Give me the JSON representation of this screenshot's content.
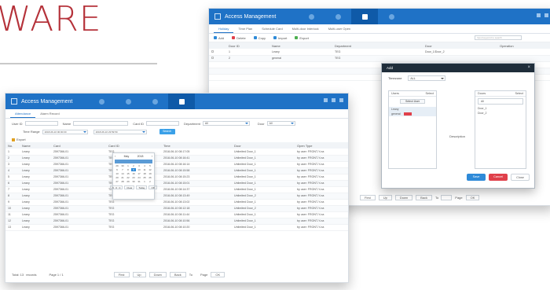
{
  "headline": {
    "text": "WARE"
  },
  "back_window": {
    "title": "Access Management",
    "nav_icons": [
      "person-icon",
      "door-icon",
      "shield-icon",
      "user-active-icon",
      "card-icon"
    ],
    "tabs": [
      "Holiday",
      "Time Plan",
      "Schedule Card",
      "Multi-door Interlock",
      "Multi-user Open"
    ],
    "toolbar": [
      {
        "icon": "add-icon",
        "label": "Add"
      },
      {
        "icon": "delete-icon",
        "label": "Delete"
      },
      {
        "icon": "copy-icon",
        "label": "Copy"
      },
      {
        "icon": "import-icon",
        "label": "Import"
      },
      {
        "icon": "export-icon",
        "label": "Export"
      }
    ],
    "search_placeholder": "Input keyword to search",
    "columns": [
      "",
      "Door ID",
      "Name",
      "Department",
      "Door",
      "Operation"
    ],
    "rows": [
      [
        "",
        "1",
        "Leany",
        "TEG",
        "Door_1/Door_2",
        ""
      ],
      [
        "",
        "2",
        "general",
        "TEG",
        "",
        ""
      ]
    ],
    "pager": {
      "first": "First",
      "prev": "Up",
      "next": "Down",
      "last": "Back",
      "to": "To",
      "page_label": "Page",
      "go": "OK"
    }
  },
  "front_window": {
    "title": "Access Management",
    "nav_icons": [
      "person-icon",
      "door-icon",
      "shield-icon",
      "id-card-active-icon"
    ],
    "tabs": [
      "Attendance",
      "Alarm Record"
    ],
    "filters": {
      "user_id_label": "User ID",
      "name_label": "Name",
      "card_id_label": "Card ID",
      "department_label": "Department",
      "department_value": "All",
      "door_label": "Door",
      "door_value": "All",
      "time_range_label": "Time Range",
      "time_range_start": "2018-06-10 00:00:00",
      "time_range_end": "2018-06-10 23:59:59",
      "search_button": "Search"
    },
    "export_label": "Export",
    "columns": [
      "No.",
      "Name",
      "Card",
      "Card ID",
      "Time",
      "Door",
      "Open Type"
    ],
    "rows": [
      [
        "1",
        "Leany",
        "2597366-01",
        "TEG",
        "2018-06-10 08:17:05",
        "Unlimited Door_1",
        "by user: FRONT-Y-na"
      ],
      [
        "2",
        "Leany",
        "2597366-01",
        "TEG",
        "2018-06-10 08:16:41",
        "Unlimited Door_1",
        "by user: FRONT-Y-na"
      ],
      [
        "3",
        "Leany",
        "2597366-01",
        "TEG",
        "2018-06-10 08:16:14",
        "Unlimited Door_1",
        "by user: FRONT-Y-na"
      ],
      [
        "4",
        "Leany",
        "2597366-01",
        "TEG",
        "2018-06-10 08:15:58",
        "Unlimited Door_1",
        "by user: FRONT-Y-na"
      ],
      [
        "5",
        "Leany",
        "2597366-01",
        "TEG",
        "2018-06-10 08:15:23",
        "Unlimited Door_1",
        "by user: FRONT-Y-na"
      ],
      [
        "6",
        "Leany",
        "2597366-01",
        "TEG",
        "2018-06-10 08:15:01",
        "Unlimited Door_1",
        "by user: FRONT-Y-na"
      ],
      [
        "7",
        "Leany",
        "2597366-01",
        "TEG",
        "2018-06-10 08:14:37",
        "Unlimited Door_1",
        "by user: FRONT-Y-na"
      ],
      [
        "8",
        "Leany",
        "2597366-01",
        "TEG",
        "2018-06-10 08:13:49",
        "Unlimited Door_2",
        "by user: FRONT-Y-na"
      ],
      [
        "9",
        "Leany",
        "2597366-01",
        "TEG",
        "2018-06-10 08:13:02",
        "Unlimited Door_1",
        "by user: FRONT-Y-na"
      ],
      [
        "10",
        "Leany",
        "2597366-01",
        "TEG",
        "2018-06-10 08:12:18",
        "Unlimited Door_2",
        "by user: FRONT-Y-na"
      ],
      [
        "11",
        "Leany",
        "2597366-01",
        "TEG",
        "2018-06-10 08:11:44",
        "Unlimited Door_1",
        "by user: FRONT-Y-na"
      ],
      [
        "12",
        "Leany",
        "2597366-01",
        "TEG",
        "2018-06-10 08:10:56",
        "Unlimited Door_1",
        "by user: FRONT-Y-na"
      ],
      [
        "13",
        "Leany",
        "2597366-01",
        "TEG",
        "2018-06-10 08:10:20",
        "Unlimited Door_1",
        "by user: FRONT-Y-na"
      ]
    ],
    "calendar": {
      "month": "May",
      "year": "2018",
      "days": [
        "29",
        "30",
        "1",
        "2",
        "3",
        "4",
        "5",
        "6",
        "7",
        "8",
        "9",
        "10",
        "11",
        "12",
        "13",
        "14",
        "15",
        "16",
        "17",
        "18",
        "19",
        "20",
        "21",
        "22",
        "23",
        "24",
        "25",
        "26",
        "27",
        "28",
        "29",
        "30",
        "31",
        "1",
        "2"
      ],
      "highlight_index": 10,
      "time": "0 : 0 : 0",
      "clear": "Clear",
      "today": "Today",
      "ok": "OK"
    },
    "pager": {
      "total": "Total: 13",
      "records": "records",
      "page_info": "Page 1 / 1",
      "first": "First",
      "prev": "Up",
      "next": "Down",
      "last": "Back",
      "to": "To",
      "page_label": "Page",
      "go": "OK"
    }
  },
  "dialog": {
    "title": "Add",
    "timezone_label": "Timezone",
    "timezone_value": "ALL",
    "user_panel_label": "Users",
    "user_panel_hint": "Select",
    "select_user_button": "Select User",
    "users": [
      "Leany",
      "general"
    ],
    "doors_panel_label": "Doors",
    "doors_panel_hint": "Select",
    "doors_all": "All",
    "doors": [
      "Door_1",
      "Door_2"
    ],
    "description_label": "Description",
    "save_button": "Save",
    "cancel_button": "Cancel",
    "close_button": "Close",
    "accent_colors": {
      "primary": "#2e8ad8",
      "danger": "#e0404a",
      "title_bar": "#1f72c6"
    }
  }
}
